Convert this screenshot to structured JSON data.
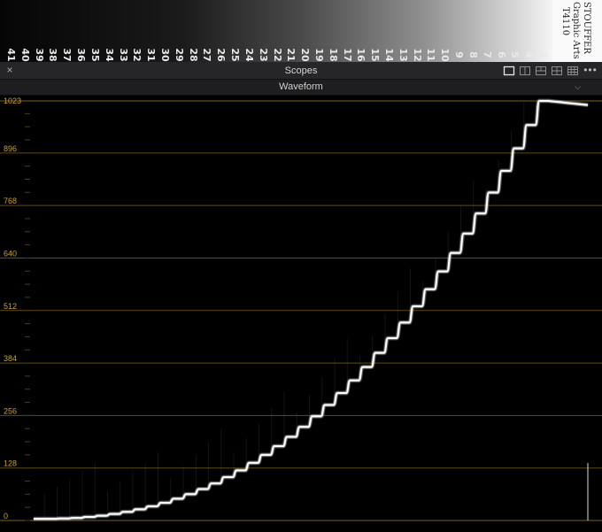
{
  "step_wedge": {
    "numbers": [
      "41",
      "40",
      "39",
      "38",
      "37",
      "36",
      "35",
      "34",
      "33",
      "32",
      "31",
      "30",
      "29",
      "28",
      "27",
      "26",
      "25",
      "24",
      "23",
      "22",
      "21",
      "20",
      "19",
      "18",
      "17",
      "16",
      "15",
      "14",
      "13",
      "12",
      "11",
      "10",
      "9",
      "8",
      "7",
      "6",
      "5",
      "4",
      "3"
    ],
    "label_lines": [
      "STOUFFER",
      "Graphic Arts",
      "T4110"
    ]
  },
  "panel": {
    "title": "Scopes",
    "close_icon": "close-icon",
    "more_icon": "more-horizontal-icon",
    "layout_icons": [
      "layout-single-icon",
      "layout-dual-icon",
      "layout-quad-vertical-icon",
      "layout-quad-icon",
      "layout-grid-icon"
    ]
  },
  "scope_selector": {
    "value": "Waveform",
    "icon": "chevron-down-icon"
  },
  "waveform": {
    "scale_labels": [
      "1023",
      "896",
      "768",
      "640",
      "512",
      "384",
      "256",
      "128",
      "0"
    ],
    "graticule_color": "#8a6a1a",
    "label_color": "#c9a13c",
    "trace_color": "#ffffff"
  }
}
